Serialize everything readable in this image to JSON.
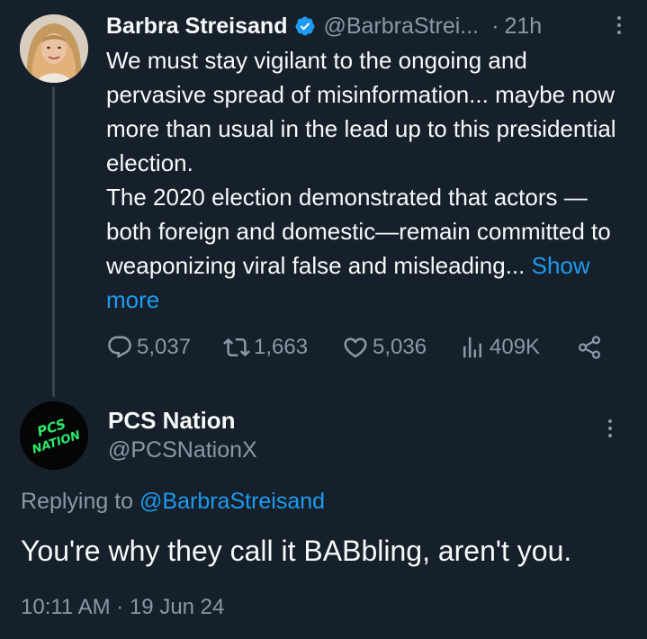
{
  "tweet": {
    "author_name": "Barbra Streisand",
    "author_handle": "@BarbraStrei...",
    "separator": "·",
    "time": "21h",
    "text_lines": [
      "We must stay vigilant to the ongoing and pervasive spread of misinformation... maybe now more than usual in the lead up to this presidential election.",
      "The 2020 election demonstrated that actors —both foreign and domestic—remain committed to weaponizing viral false and misleading..."
    ],
    "show_more": "Show more",
    "replies": "5,037",
    "reposts": "1,663",
    "likes": "5,036",
    "views": "409K"
  },
  "reply": {
    "author_name": "PCS Nation",
    "author_handle": "@PCSNationX",
    "avatar_text_line1": "PCS",
    "avatar_text_line2": "NATION",
    "replying_prefix": "Replying to",
    "replying_to": "@BarbraStreisand",
    "text": "You're why they call it BABbling, aren't you.",
    "timestamp": "10:11 AM · 19 Jun 24"
  },
  "colors": {
    "background": "#15202b",
    "text": "#f7f9f9",
    "secondary": "#8b98a5",
    "accent": "#1d9bf0",
    "avatar_logo": "#2ee86a"
  },
  "icons": {
    "verified": "verified-badge-icon",
    "reply": "reply-icon",
    "repost": "repost-icon",
    "like": "heart-icon",
    "views": "views-chart-icon",
    "share": "share-icon",
    "more": "more-vertical-icon"
  }
}
